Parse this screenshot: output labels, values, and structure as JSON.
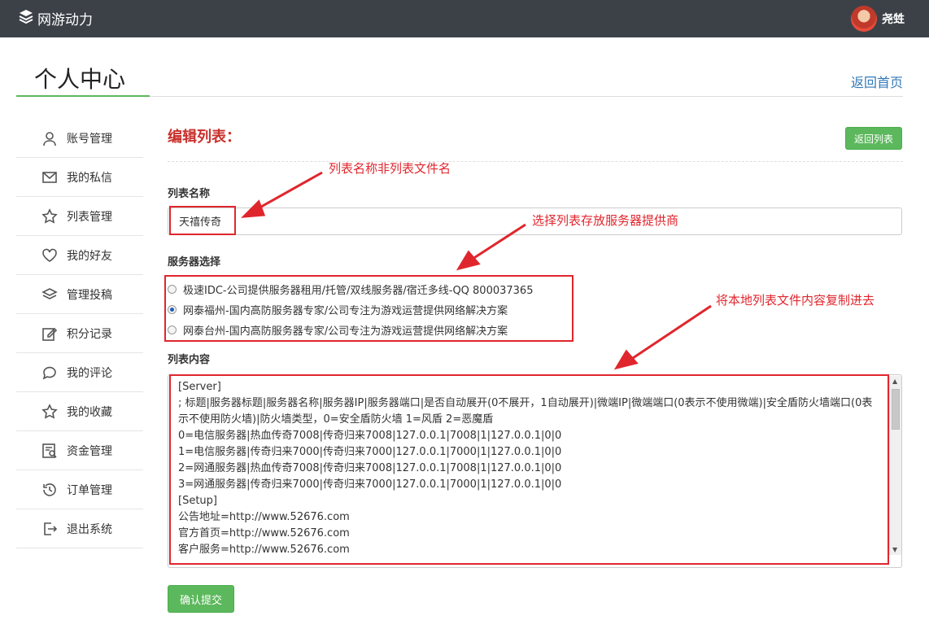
{
  "topbar": {
    "brand": "网游动力",
    "username": "尧甡"
  },
  "header": {
    "title": "个人中心",
    "home_link": "返回首页"
  },
  "sidebar": {
    "items": [
      {
        "label": "账号管理",
        "icon": "user-icon"
      },
      {
        "label": "我的私信",
        "icon": "mail-icon"
      },
      {
        "label": "列表管理",
        "icon": "star-icon"
      },
      {
        "label": "我的好友",
        "icon": "heart-icon"
      },
      {
        "label": "管理投稿",
        "icon": "layers-icon"
      },
      {
        "label": "积分记录",
        "icon": "edit-icon"
      },
      {
        "label": "我的评论",
        "icon": "comment-icon"
      },
      {
        "label": "我的收藏",
        "icon": "star-icon"
      },
      {
        "label": "资金管理",
        "icon": "finance-icon"
      },
      {
        "label": "订单管理",
        "icon": "history-icon"
      },
      {
        "label": "退出系统",
        "icon": "logout-icon"
      }
    ]
  },
  "form": {
    "section_title": "编辑列表：",
    "back_button": "返回列表",
    "name_label": "列表名称",
    "name_value": "天禧传奇",
    "server_label": "服务器选择",
    "servers": [
      {
        "label": "极速IDC-公司提供服务器租用/托管/双线服务器/宿迁多线-QQ 800037365",
        "selected": false
      },
      {
        "label": "网泰福州-国内高防服务器专家/公司专注为游戏运营提供网络解决方案",
        "selected": true
      },
      {
        "label": "网泰台州-国内高防服务器专家/公司专注为游戏运营提供网络解决方案",
        "selected": false
      }
    ],
    "content_label": "列表内容",
    "content_lines": [
      "[Server]",
      "; 标题|服务器标题|服务器名称|服务器IP|服务器端口|是否自动展开(0不展开，1自动展开)|微端IP|微端端口(0表示不使用微端)|安全盾防火墙端口(0表示不使用防火墙)|防火墙类型，0=安全盾防火墙 1=风盾 2=恶魔盾",
      "0=电信服务器|热血传奇7008|传奇归来7008|127.0.0.1|7008|1|127.0.0.1|0|0",
      "1=电信服务器|传奇归来7000|传奇归来7000|127.0.0.1|7000|1|127.0.0.1|0|0",
      "2=网通服务器|热血传奇7008|传奇归来7008|127.0.0.1|7008|1|127.0.0.1|0|0",
      "3=网通服务器|传奇归来7000|传奇归来7000|127.0.0.1|7000|1|127.0.0.1|0|0",
      "[Setup]",
      "公告地址=http://www.52676.com",
      "官方首页=http://www.52676.com",
      "客户服务=http://www.52676.com"
    ],
    "submit_button": "确认提交"
  },
  "annotations": {
    "name_note": "列表名称非列表文件名",
    "server_note": "选择列表存放服务器提供商",
    "content_note": "将本地列表文件内容复制进去",
    "color": "#e0262d"
  },
  "colors": {
    "topbar": "#3c4148",
    "accent_green": "#5cb85c",
    "title_red": "#c9302c",
    "link_blue": "#337ab7"
  }
}
